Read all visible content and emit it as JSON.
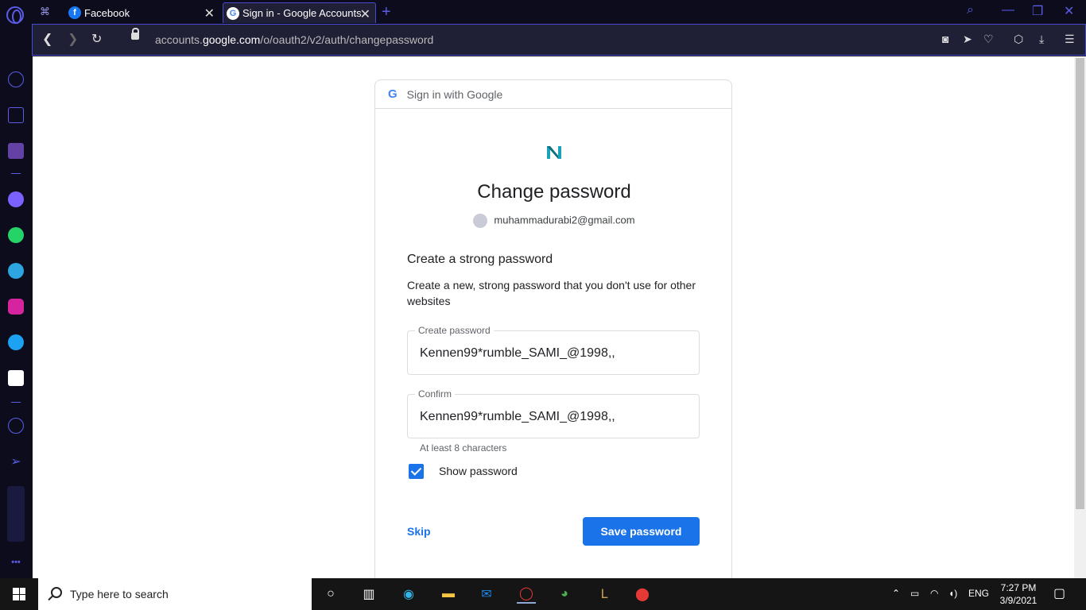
{
  "tabs": [
    {
      "title": "Facebook",
      "icon": "facebook-icon"
    },
    {
      "title": "Sign in - Google Accounts",
      "icon": "google-icon"
    }
  ],
  "address_bar": {
    "url_prefix": "accounts.",
    "url_domain": "google.com",
    "url_path": "/o/oauth2/v2/auth/changepassword"
  },
  "card": {
    "header": "Sign in with Google",
    "title": "Change password",
    "account_email": "muhammadurabi2@gmail.com",
    "subtitle": "Create a strong password",
    "description": "Create a new, strong password that you don't use for other websites",
    "create_field": {
      "label": "Create password",
      "value": "Kennen99*rumble_SAMI_@1998,,"
    },
    "confirm_field": {
      "label": "Confirm",
      "value": "Kennen99*rumble_SAMI_@1998,,"
    },
    "hint": "At least 8 characters",
    "show_password": {
      "label": "Show password",
      "checked": true
    },
    "skip_label": "Skip",
    "save_label": "Save password"
  },
  "taskbar": {
    "search_placeholder": "Type here to search",
    "language": "ENG",
    "time": "7:27 PM",
    "date": "3/9/2021"
  },
  "colors": {
    "accent": "#1a73e8",
    "opera_accent": "#5a5ce6"
  }
}
